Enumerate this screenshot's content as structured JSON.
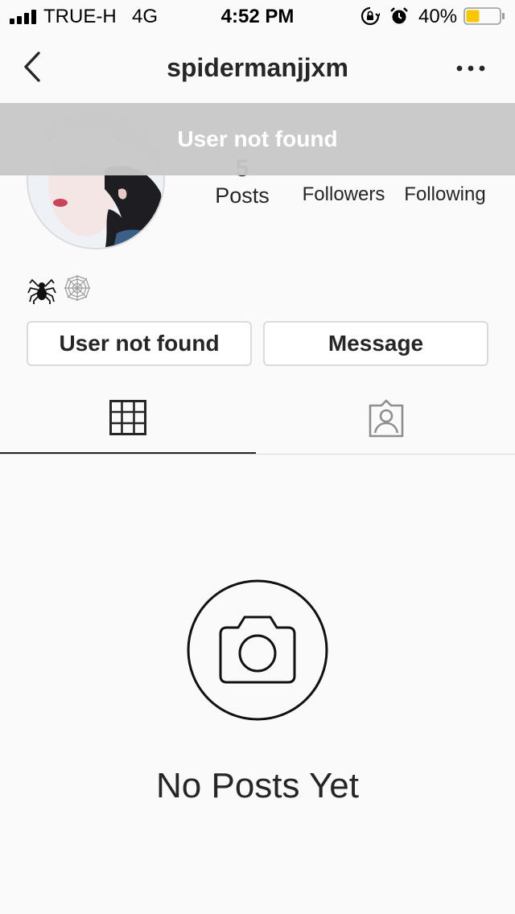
{
  "status_bar": {
    "carrier": "TRUE-H",
    "network": "4G",
    "time": "4:52 PM",
    "battery_percent": "40%",
    "battery_level": 0.4,
    "icons": [
      "signal-icon",
      "orientation-lock-icon",
      "alarm-icon",
      "battery-icon"
    ]
  },
  "header": {
    "back_icon": "chevron-left-icon",
    "username": "spidermanjjxm",
    "more_icon": "more-dots-icon"
  },
  "toast": {
    "message": "User not found"
  },
  "profile": {
    "stats": {
      "posts_count": "5",
      "posts_label": "Posts",
      "followers_label": "Followers",
      "following_label": "Following"
    },
    "bio_emojis": [
      "spider-icon",
      "spider-web-icon"
    ]
  },
  "actions": {
    "follow_label": "User not found",
    "message_label": "Message"
  },
  "tabs": [
    {
      "name": "grid",
      "icon": "grid-icon",
      "active": true
    },
    {
      "name": "tagged",
      "icon": "tagged-user-icon",
      "active": false
    }
  ],
  "empty_state": {
    "icon": "camera-icon",
    "message": "No Posts Yet"
  },
  "colors": {
    "background": "#fafafa",
    "text": "#262626",
    "border": "#dbdbdb",
    "toast_bg": "#c8c8c8",
    "battery_fill": "#f7c800"
  }
}
